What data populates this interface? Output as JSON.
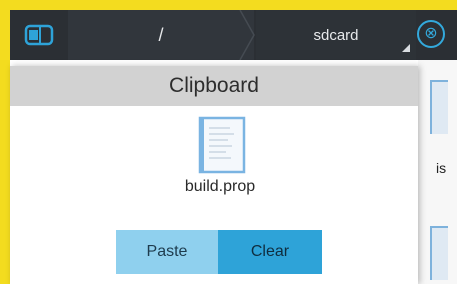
{
  "toolbar": {
    "panel_icon": "split-panel-icon",
    "breadcrumb": [
      {
        "label": "/"
      },
      {
        "label": "sdcard"
      }
    ],
    "close_icon": "close-circle-icon",
    "close_symbol": "⊗"
  },
  "dialog": {
    "title": "Clipboard",
    "file": {
      "icon": "document-file-icon",
      "name": "build.prop"
    },
    "buttons": {
      "paste": "Paste",
      "clear": "Clear"
    }
  },
  "background": {
    "right_label": "is"
  },
  "colors": {
    "frame": "#f3dc1f",
    "toolbar": "#2b2f34",
    "accent": "#2ea3d8",
    "accent_light": "#8fd0ee",
    "title_bar": "#d2d2d2"
  }
}
